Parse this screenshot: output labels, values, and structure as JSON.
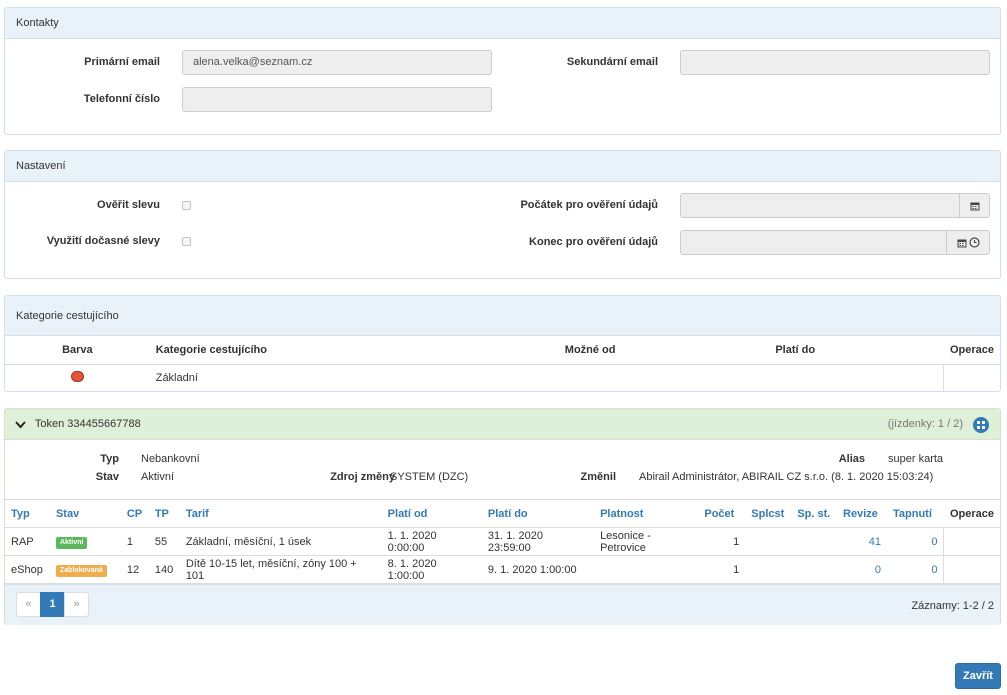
{
  "contacts": {
    "heading": "Kontakty",
    "primary_email_label": "Primární email",
    "primary_email_value": "alena.velka@seznam.cz",
    "secondary_email_label": "Sekundární email",
    "secondary_email_value": "",
    "phone_label": "Telefonní číslo",
    "phone_value": ""
  },
  "settings": {
    "heading": "Nastavení",
    "verify_discount_label": "Ověřit slevu",
    "temp_discount_label": "Využití dočasné slevy",
    "verify_start_label": "Počátek pro ověření údajů",
    "verify_end_label": "Konec pro ověření údajů"
  },
  "category": {
    "heading": "Kategorie cestujícího",
    "columns": [
      "Barva",
      "Kategorie cestujícího",
      "Možné od",
      "Platí do",
      "Operace"
    ],
    "rows": [
      {
        "color": "#e4533a",
        "category": "Základní",
        "from": "",
        "until": "",
        "ops": ""
      }
    ]
  },
  "token": {
    "heading": "Token 334455667788",
    "tickets_info": "(jízdenky: 1 / 2)",
    "typ_label": "Typ",
    "typ_value": "Nebankovní",
    "stav_label": "Stav",
    "stav_value": "Aktivní",
    "source_label": "Zdroj změny",
    "source_value": "SYSTEM (DZC)",
    "changed_label": "Změnil",
    "changed_value": "Abirail Administrátor, ABIRAIL CZ s.r.o. (8. 1. 2020 15:03:24)",
    "alias_label": "Alias",
    "alias_value": "super karta",
    "columns": [
      "Typ",
      "Stav",
      "CP",
      "TP",
      "Tarif",
      "Platí od",
      "Platí do",
      "Platnost",
      "Počet",
      "Splcst",
      "Sp. st.",
      "Revize",
      "Tapnutí",
      "Operace"
    ],
    "rows": [
      {
        "typ": "RAP",
        "stav": "Aktivní",
        "stav_color": "#5cb85c",
        "cp": "1",
        "tp": "55",
        "tarif": "Základní, měsíční, 1 úsek",
        "od": "1. 1. 2020 0:00:00",
        "do": "31. 1. 2020 23:59:00",
        "platnost": "Lesonice - Petrovice",
        "pocet": "1",
        "splcst": "",
        "spst": "",
        "revize": "41",
        "tapnuti": "0"
      },
      {
        "typ": "eShop",
        "stav": "Zablokovaná",
        "stav_color": "#f0ad4e",
        "cp": "12",
        "tp": "140",
        "tarif": "Dítě 10-15 let, měsíční, zóny 100 + 101",
        "od": "8. 1. 2020 1:00:00",
        "do": "9. 1. 2020 1:00:00",
        "platnost": "",
        "pocet": "1",
        "splcst": "",
        "spst": "",
        "revize": "0",
        "tapnuti": "0"
      }
    ],
    "pager": {
      "prev": "«",
      "page": "1",
      "next": "»"
    },
    "records": "Záznamy: 1-2 / 2"
  },
  "close_button": "Zavřít",
  "icons": {
    "collapse": "chevron-down-icon",
    "grid": "grid-icon",
    "calendar": "calendar-icon",
    "clock": "clock-icon"
  }
}
